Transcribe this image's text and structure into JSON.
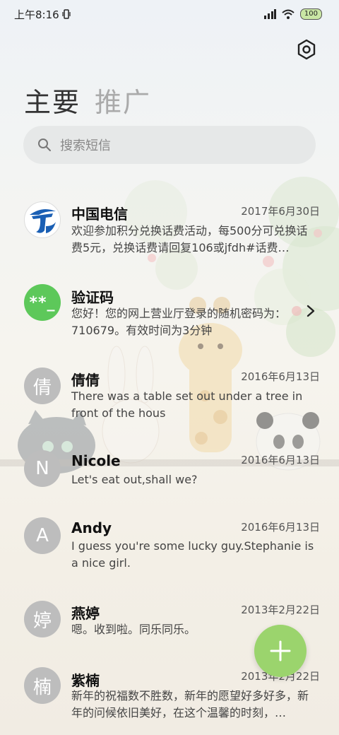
{
  "status_bar": {
    "time": "上午8:16",
    "battery": "100"
  },
  "tabs": {
    "main": "主要",
    "promo": "推广"
  },
  "search": {
    "placeholder": "搜索短信"
  },
  "messages": [
    {
      "name": "中国电信",
      "date": "2017年6月30日",
      "preview": "欢迎参加积分兑换话费活动，每500分可兑换话费5元，兑换话费请回复106或jfdh#话费…",
      "avatar_type": "telecom-logo"
    },
    {
      "name": "验证码",
      "date": "",
      "preview": "您好！您的网上营业厅登录的随机密码为：710679。有效时间为3分钟",
      "avatar_text": "**_"
    },
    {
      "name": "倩倩",
      "date": "2016年6月13日",
      "preview": "There was a table set out under a tree in front of the hous",
      "avatar_text": "倩"
    },
    {
      "name": "Nicole",
      "date": "2016年6月13日",
      "preview": "Let's eat out,shall we?",
      "avatar_text": "N"
    },
    {
      "name": "Andy",
      "date": "2016年6月13日",
      "preview": "I guess you're some lucky guy.Stephanie is a nice girl.",
      "avatar_text": "A"
    },
    {
      "name": "燕婷",
      "date": "2013年2月22日",
      "preview": "嗯。收到啦。同乐同乐。",
      "avatar_text": "婷"
    },
    {
      "name": "紫楠",
      "date": "2013年2月22日",
      "preview": "新年的祝福数不胜数，新年的愿望好多好多，新年的问候依旧美好，在这个温馨的时刻，…",
      "avatar_text": "楠"
    }
  ],
  "colors": {
    "fab": "#9bd46d",
    "verify_avatar": "#5dc85a",
    "default_avatar": "#bdbdbd"
  }
}
